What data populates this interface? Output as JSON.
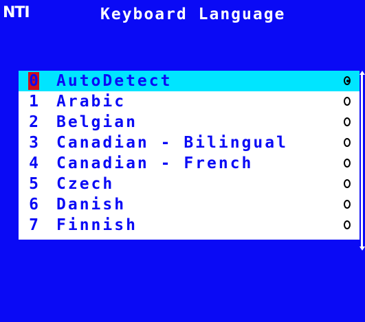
{
  "header": {
    "logo": "NTI",
    "title": "Keyboard Language"
  },
  "colors": {
    "background": "#0a0af5",
    "panel": "#ffffff",
    "selection": "#00e5ff",
    "cursor": "#d0101a",
    "text": "#0a0af5"
  },
  "languages": {
    "selected_index": 0,
    "items": [
      {
        "num": "0",
        "label": "AutoDetect",
        "checked": true
      },
      {
        "num": "1",
        "label": "Arabic",
        "checked": false
      },
      {
        "num": "2",
        "label": "Belgian",
        "checked": false
      },
      {
        "num": "3",
        "label": "Canadian - Bilingual",
        "checked": false
      },
      {
        "num": "4",
        "label": "Canadian - French",
        "checked": false
      },
      {
        "num": "5",
        "label": "Czech",
        "checked": false
      },
      {
        "num": "6",
        "label": "Danish",
        "checked": false
      },
      {
        "num": "7",
        "label": "Finnish",
        "checked": false
      }
    ]
  },
  "icons": {
    "radio_checked": "radio-checked-icon",
    "radio_unchecked": "radio-unchecked-icon",
    "scroll_up": "scroll-up-arrow-icon",
    "scroll_down": "scroll-down-arrow-icon"
  }
}
